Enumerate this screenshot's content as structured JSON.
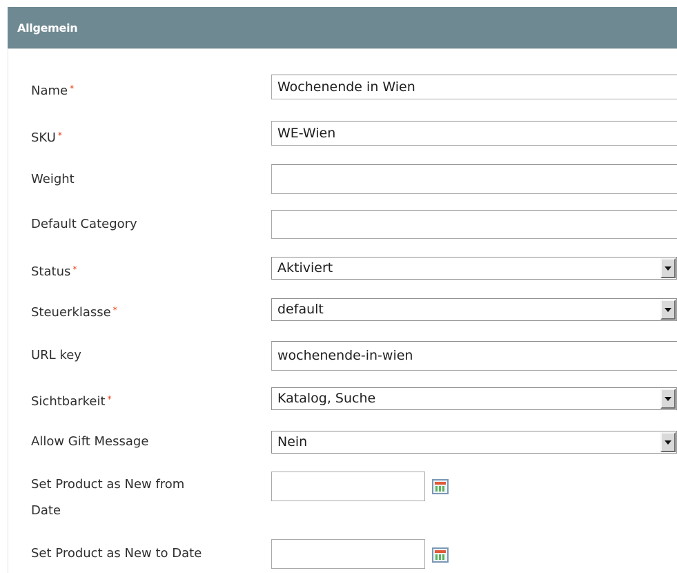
{
  "section": {
    "title": "Allgemein"
  },
  "required_marker": "*",
  "fields": {
    "name": {
      "label": "Name",
      "value": "Wochenende in Wien"
    },
    "sku": {
      "label": "SKU",
      "value": "WE-Wien"
    },
    "weight": {
      "label": "Weight",
      "value": ""
    },
    "default_category": {
      "label": "Default Category",
      "value": ""
    },
    "status": {
      "label": "Status",
      "value": "Aktiviert"
    },
    "tax_class": {
      "label": "Steuerklasse",
      "value": "default"
    },
    "url_key": {
      "label": "URL key",
      "value": "wochenende-in-wien"
    },
    "visibility": {
      "label": "Sichtbarkeit",
      "value": "Katalog, Suche"
    },
    "gift_message": {
      "label": "Allow Gift Message",
      "value": "Nein"
    },
    "new_from": {
      "label_line1": "Set Product as New from",
      "label_line2": "Date",
      "value": ""
    },
    "new_to": {
      "label": "Set Product as New to Date",
      "value": ""
    }
  },
  "colors": {
    "header_bg": "#6f8992",
    "required": "#eb340a"
  },
  "icons": {
    "date_picker": "calendar-icon",
    "dropdown": "chevron-down-icon"
  }
}
